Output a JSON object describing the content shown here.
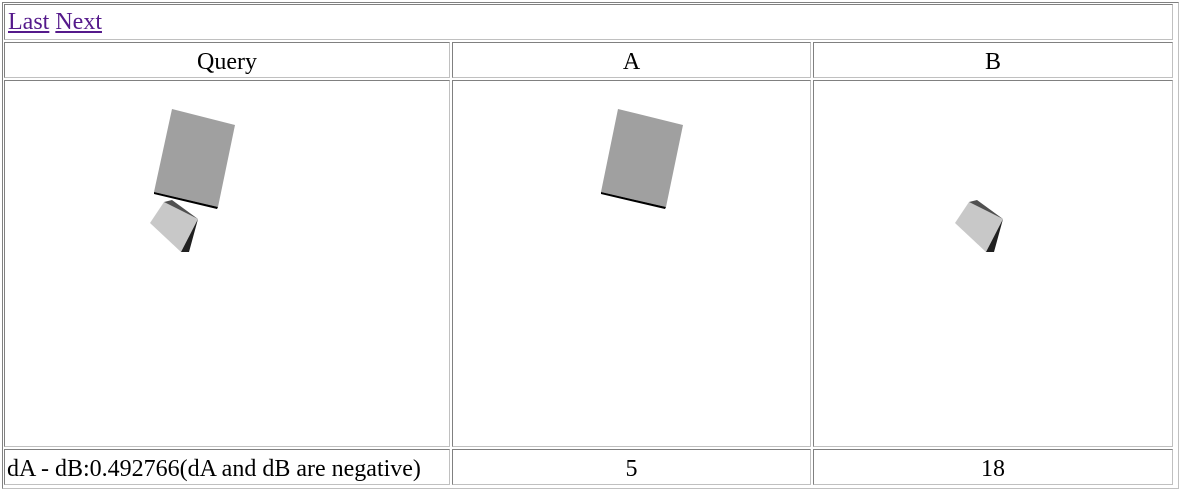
{
  "nav": {
    "last_label": "Last",
    "next_label": "Next"
  },
  "table": {
    "headers": [
      "Query",
      "A",
      "B"
    ],
    "footer": {
      "query": "dA - dB:0.492766(dA and dB are negative)",
      "a": "5",
      "b": "18"
    }
  },
  "colors": {
    "link": "#551a8b",
    "border_dark": "#808080",
    "border_light": "#c0c0c0",
    "box_gray": "#a0a0a0",
    "cube_light": "#c8c8c8",
    "cube_dark": "#202020",
    "cube_mid": "#505050"
  }
}
